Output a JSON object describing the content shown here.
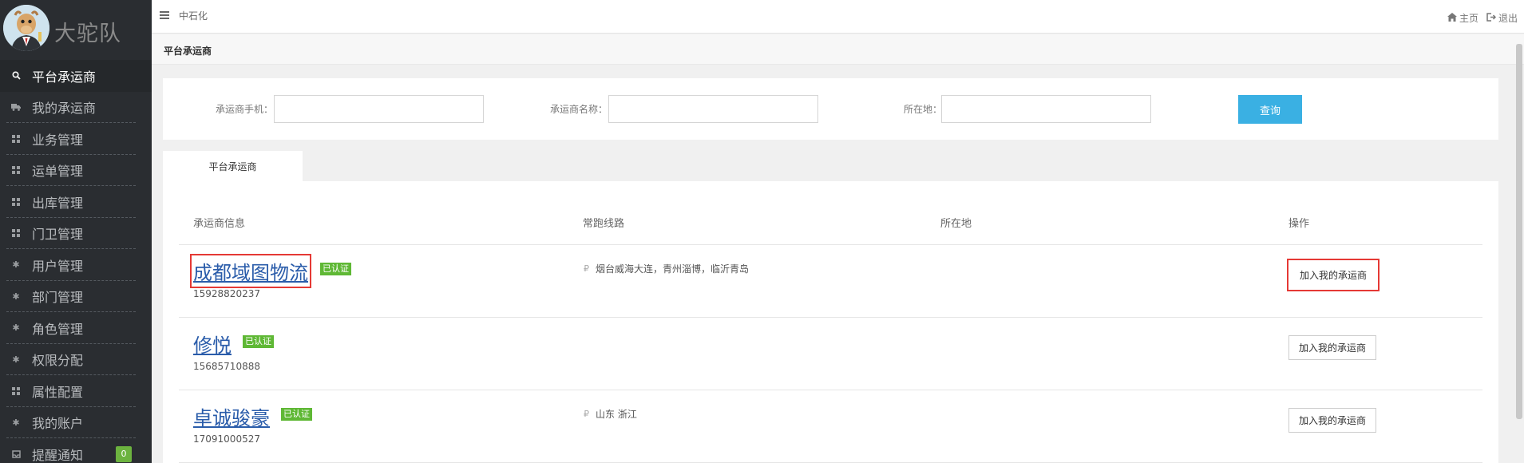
{
  "brand": {
    "name": "大驼队"
  },
  "sidebar": {
    "items": [
      {
        "label": "平台承运商",
        "icon": "search-icon",
        "active": true
      },
      {
        "label": "我的承运商",
        "icon": "truck-icon"
      },
      {
        "label": "业务管理",
        "icon": "grid-icon"
      },
      {
        "label": "运单管理",
        "icon": "grid-icon"
      },
      {
        "label": "出库管理",
        "icon": "grid-icon"
      },
      {
        "label": "门卫管理",
        "icon": "grid-icon"
      },
      {
        "label": "用户管理",
        "icon": "gear-icon"
      },
      {
        "label": "部门管理",
        "icon": "gear-icon"
      },
      {
        "label": "角色管理",
        "icon": "gear-icon"
      },
      {
        "label": "权限分配",
        "icon": "gear-icon"
      },
      {
        "label": "属性配置",
        "icon": "grid-icon"
      },
      {
        "label": "我的账户",
        "icon": "gear-icon"
      },
      {
        "label": "提醒通知",
        "icon": "inbox-icon",
        "badge": "0"
      }
    ]
  },
  "topbar": {
    "company": "中石化",
    "home_label": "主页",
    "logout_label": "退出"
  },
  "page": {
    "title": "平台承运商"
  },
  "search": {
    "phone_label": "承运商手机：",
    "phone_value": "",
    "name_label": "承运商名称：",
    "name_value": "",
    "location_label": "所在地：",
    "location_value": "",
    "button_label": "查询"
  },
  "tabs": [
    {
      "label": "平台承运商"
    }
  ],
  "table": {
    "headers": [
      "承运商信息",
      "常跑线路",
      "所在地",
      "操作"
    ],
    "rows": [
      {
        "name": "成都域图物流",
        "verified": "已认证",
        "phone": "15928820237",
        "route": "烟台威海大连，青州淄博，临沂青岛",
        "location": "",
        "action": "加入我的承运商"
      },
      {
        "name": "修悦",
        "verified": "已认证",
        "phone": "15685710888",
        "route": "",
        "location": "",
        "action": "加入我的承运商"
      },
      {
        "name": "卓诚骏豪",
        "verified": "已认证",
        "phone": "17091000527",
        "route": "山东 浙江",
        "location": "",
        "action": "加入我的承运商"
      }
    ]
  },
  "colors": {
    "sidebar_bg": "#2a2d31",
    "accent_blue": "#3ab0e3",
    "link_blue": "#2a5caa",
    "verified_green": "#5fb835",
    "highlight_red": "#e53935"
  }
}
